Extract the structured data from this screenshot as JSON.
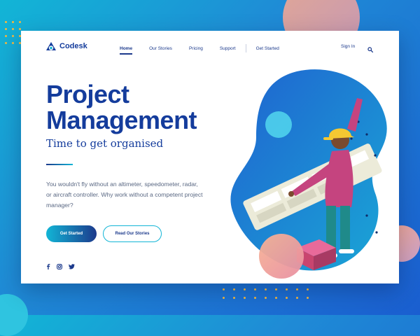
{
  "brand": {
    "name": "Codesk"
  },
  "nav": {
    "links": [
      "Home",
      "Our Stories",
      "Pricing",
      "Support"
    ],
    "get_started": "Get Started",
    "sign_in": "Sign In"
  },
  "hero": {
    "title_line1": "Project",
    "title_line2": "Management",
    "subtitle": "Time to get organised",
    "description": "You wouldn't fly without an altimeter, speedometer, radar, or aircraft controller. Why work without a competent project manager?",
    "primary_button": "Get Started",
    "secondary_button": "Read Our Stories"
  },
  "socials": [
    "facebook-icon",
    "instagram-icon",
    "twitter-icon"
  ],
  "colors": {
    "brand_navy": "#143c9c",
    "accent_cyan": "#12b5d6",
    "dot_yellow": "#f4b940",
    "peach": "#f6a98f"
  }
}
